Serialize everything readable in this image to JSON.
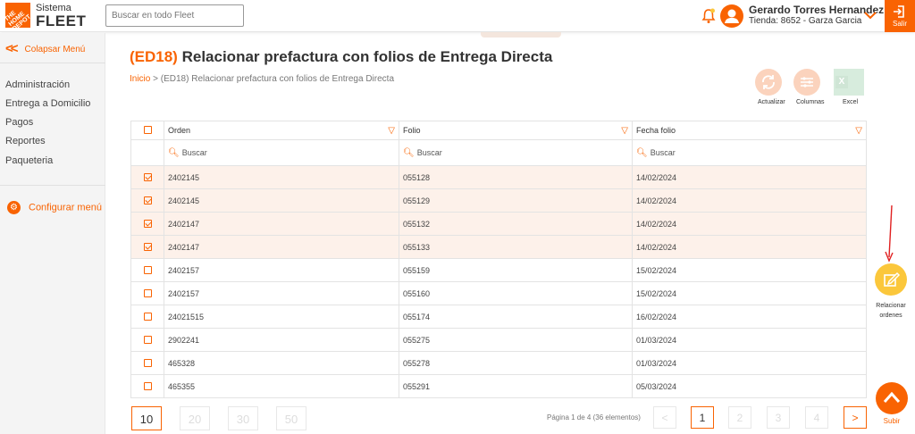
{
  "header": {
    "logo_text": "THE HOME DEPOT",
    "brand_top": "Sistema",
    "brand_bottom": "FLEET",
    "search_placeholder": "Buscar en todo Fleet",
    "user_name": "Gerardo Torres Hernandez",
    "store": "Tienda: 8652 - Garza Garcia",
    "logout_label": "Salir",
    "accent_color": "#f96302"
  },
  "sidebar": {
    "collapse_label": "Colapsar Menú",
    "items": [
      "Administración",
      "Entrega a Domicilio",
      "Pagos",
      "Reportes",
      "Paqueteria"
    ],
    "config_label": "Configurar menú"
  },
  "page": {
    "title_code": "(ED18)",
    "title_text": "Relacionar prefactura con folios de Entrega Directa",
    "breadcrumb_home": "Inicio",
    "breadcrumb_sep": ">",
    "breadcrumb_current": "(ED18) Relacionar prefactura con folios de Entrega Directa"
  },
  "toolbar": {
    "refresh_label": "Actualizar",
    "columns_label": "Columnas",
    "excel_label": "Excel"
  },
  "table": {
    "columns": [
      "Orden",
      "Folio",
      "Fecha folio"
    ],
    "filter_placeholder": "Buscar",
    "rows": [
      {
        "checked": true,
        "orden": "2402145",
        "folio": "055128",
        "fecha": "14/02/2024"
      },
      {
        "checked": true,
        "orden": "2402145",
        "folio": "055129",
        "fecha": "14/02/2024"
      },
      {
        "checked": true,
        "orden": "2402147",
        "folio": "055132",
        "fecha": "14/02/2024"
      },
      {
        "checked": true,
        "orden": "2402147",
        "folio": "055133",
        "fecha": "14/02/2024"
      },
      {
        "checked": false,
        "orden": "2402157",
        "folio": "055159",
        "fecha": "15/02/2024"
      },
      {
        "checked": false,
        "orden": "2402157",
        "folio": "055160",
        "fecha": "15/02/2024"
      },
      {
        "checked": false,
        "orden": "24021515",
        "folio": "055174",
        "fecha": "16/02/2024"
      },
      {
        "checked": false,
        "orden": "2902241",
        "folio": "055275",
        "fecha": "01/03/2024"
      },
      {
        "checked": false,
        "orden": "465328",
        "folio": "055278",
        "fecha": "01/03/2024"
      },
      {
        "checked": false,
        "orden": "465355",
        "folio": "055291",
        "fecha": "05/03/2024"
      }
    ]
  },
  "pagination": {
    "page_sizes": [
      "10",
      "20",
      "30",
      "50"
    ],
    "info": "Página 1 de 4 (36 elementos)",
    "pages": [
      "1",
      "2",
      "3",
      "4"
    ],
    "prev": "<",
    "next": ">"
  },
  "actions": {
    "relate_label": "Relacionar ordenes",
    "up_label": "Subir"
  }
}
